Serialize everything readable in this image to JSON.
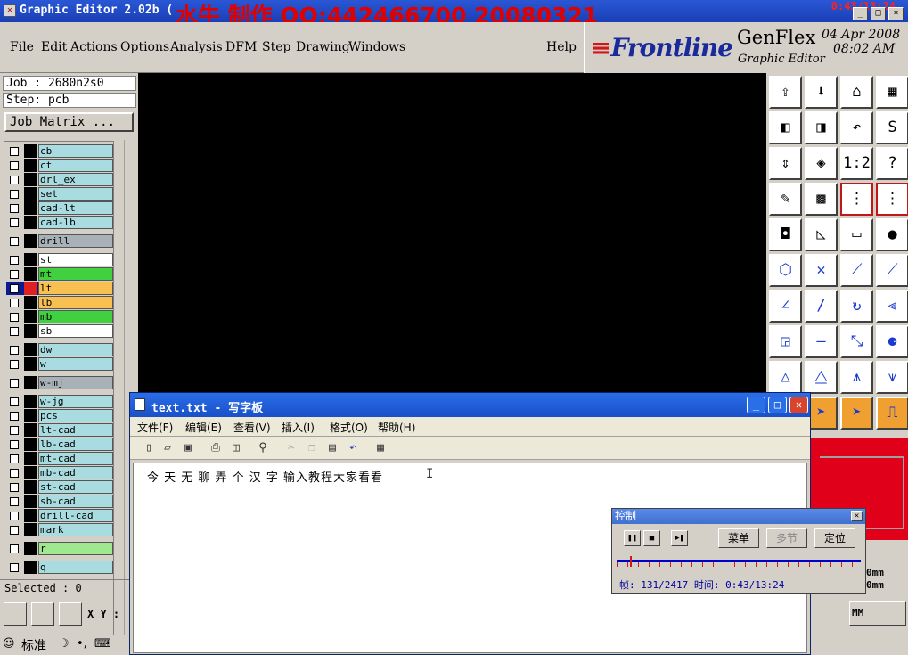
{
  "titlebar": {
    "title": "Graphic Editor 2.02b (",
    "overlay": "水牛 制作  QQ:442466700  20080321",
    "clock": "0:43/13:24",
    "min": "_",
    "max": "□",
    "close": "×"
  },
  "menu": [
    "File",
    "Edit",
    "Actions",
    "Options",
    "Analysis",
    "DFM",
    "Step",
    "Drawing",
    "Windows"
  ],
  "help": "Help",
  "brand": {
    "logo": "Frontline",
    "product": "GenFlex",
    "subtitle": "Graphic Editor",
    "date": "04 Apr 2008",
    "time": "08:02 AM"
  },
  "job": "Job : 2680n2s0",
  "step": "Step: pcb",
  "job_matrix": "Job Matrix ...",
  "layers": [
    {
      "name": "cb",
      "color": "#a8dce0",
      "swatch": "#000",
      "kind": "normal"
    },
    {
      "name": "ct",
      "color": "#a8dce0",
      "swatch": "#000",
      "kind": "normal"
    },
    {
      "name": "drl_ex",
      "color": "#a8dce0",
      "swatch": "#000",
      "kind": "normal"
    },
    {
      "name": "set",
      "color": "#a8dce0",
      "swatch": "#000",
      "kind": "normal"
    },
    {
      "name": "cad-lt",
      "color": "#a8dce0",
      "swatch": "#000",
      "kind": "normal"
    },
    {
      "name": "cad-lb",
      "color": "#a8dce0",
      "swatch": "#000",
      "kind": "normal"
    },
    {
      "name": "drill",
      "color": "#a8b0b8",
      "swatch": "#000",
      "kind": "drill"
    },
    {
      "name": "st",
      "color": "#ffffff",
      "swatch": "#000",
      "kind": "normal"
    },
    {
      "name": "mt",
      "color": "#40d040",
      "swatch": "#000",
      "kind": "normal"
    },
    {
      "name": "lt",
      "color": "#f8c050",
      "swatch": "#e02020",
      "kind": "active"
    },
    {
      "name": "lb",
      "color": "#f8c050",
      "swatch": "#000",
      "kind": "normal"
    },
    {
      "name": "mb",
      "color": "#40d040",
      "swatch": "#000",
      "kind": "normal"
    },
    {
      "name": "sb",
      "color": "#ffffff",
      "swatch": "#000",
      "kind": "normal"
    },
    {
      "name": "dw",
      "color": "#a8dce0",
      "swatch": "#000",
      "kind": "normal"
    },
    {
      "name": "w",
      "color": "#a8dce0",
      "swatch": "#000",
      "kind": "normal"
    },
    {
      "name": "w-mj",
      "color": "#a8b0b8",
      "swatch": "#000",
      "kind": "normal"
    },
    {
      "name": "w-jg",
      "color": "#a8dce0",
      "swatch": "#000",
      "kind": "normal"
    },
    {
      "name": "pcs",
      "color": "#a8dce0",
      "swatch": "#000",
      "kind": "normal"
    },
    {
      "name": "lt-cad",
      "color": "#a8dce0",
      "swatch": "#000",
      "kind": "normal"
    },
    {
      "name": "lb-cad",
      "color": "#a8dce0",
      "swatch": "#000",
      "kind": "normal"
    },
    {
      "name": "mt-cad",
      "color": "#a8dce0",
      "swatch": "#000",
      "kind": "normal"
    },
    {
      "name": "mb-cad",
      "color": "#a8dce0",
      "swatch": "#000",
      "kind": "normal"
    },
    {
      "name": "st-cad",
      "color": "#a8dce0",
      "swatch": "#000",
      "kind": "normal"
    },
    {
      "name": "sb-cad",
      "color": "#a8dce0",
      "swatch": "#000",
      "kind": "normal"
    },
    {
      "name": "drill-cad",
      "color": "#a8dce0",
      "swatch": "#000",
      "kind": "normal"
    },
    {
      "name": "mark",
      "color": "#a8dce0",
      "swatch": "#000",
      "kind": "normal"
    },
    {
      "name": "r",
      "color": "#a0e890",
      "swatch": "#000",
      "kind": "normal"
    },
    {
      "name": "q",
      "color": "#a8dce0",
      "swatch": "#000",
      "kind": "normal"
    }
  ],
  "selected": "Selected : 0",
  "xy": "X Y :",
  "right_info": {
    "v1": "0mm",
    "v2": "0mm",
    "units": "MM"
  },
  "taskbar": {
    "ime": "标准"
  },
  "tools": [
    {
      "icon": "export-icon",
      "glyph": "⇪"
    },
    {
      "icon": "import-icon",
      "glyph": "⬇"
    },
    {
      "icon": "home-icon",
      "glyph": "⌂"
    },
    {
      "icon": "window-icon",
      "glyph": "▦"
    },
    {
      "icon": "pan-left-icon",
      "glyph": "◧"
    },
    {
      "icon": "pan-right-icon",
      "glyph": "◨"
    },
    {
      "icon": "undo-icon",
      "glyph": "↶"
    },
    {
      "icon": "redraw-icon",
      "glyph": "S"
    },
    {
      "icon": "fit-icon",
      "glyph": "⇕"
    },
    {
      "icon": "zoom-icon",
      "glyph": "◈"
    },
    {
      "icon": "ratio-icon",
      "glyph": "1:2"
    },
    {
      "icon": "help-icon",
      "glyph": "?"
    },
    {
      "icon": "tools-icon",
      "glyph": "✎"
    },
    {
      "icon": "grid-icon",
      "glyph": "▩"
    },
    {
      "icon": "net-icon",
      "glyph": "⋮"
    },
    {
      "icon": "net2-icon",
      "glyph": "⋮"
    },
    {
      "icon": "select-icon",
      "glyph": "◘"
    },
    {
      "icon": "polygon-icon",
      "glyph": "◺"
    },
    {
      "icon": "ruler-icon",
      "glyph": "▭"
    },
    {
      "icon": "dot-icon",
      "glyph": "●"
    },
    {
      "icon": "route-icon",
      "glyph": "⬡"
    },
    {
      "icon": "cross-icon",
      "glyph": "✕"
    },
    {
      "icon": "line-icon",
      "glyph": "⟋"
    },
    {
      "icon": "line2-icon",
      "glyph": "⟋"
    },
    {
      "icon": "angle-icon",
      "glyph": "∠"
    },
    {
      "icon": "slash-icon",
      "glyph": "∕"
    },
    {
      "icon": "arc-icon",
      "glyph": "↻"
    },
    {
      "icon": "mirror-icon",
      "glyph": "⫷"
    },
    {
      "icon": "move-icon",
      "glyph": "◲"
    },
    {
      "icon": "dash-icon",
      "glyph": "—"
    },
    {
      "icon": "stretch-icon",
      "glyph": "⤡"
    },
    {
      "icon": "pads-icon",
      "glyph": "⚈"
    },
    {
      "icon": "tri1-icon",
      "glyph": "△"
    },
    {
      "icon": "tri2-icon",
      "glyph": "⧋"
    },
    {
      "icon": "tri3-icon",
      "glyph": "⩚"
    },
    {
      "icon": "tri4-icon",
      "glyph": "⩛"
    },
    {
      "icon": "pointer-icon",
      "glyph": "➤"
    },
    {
      "icon": "pointer2-icon",
      "glyph": "➤"
    },
    {
      "icon": "pointer3-icon",
      "glyph": "➤"
    },
    {
      "icon": "step-icon",
      "glyph": "⎍"
    }
  ],
  "wordpad": {
    "title": "text.txt - 写字板",
    "menu": [
      "文件(F)",
      "编辑(E)",
      "查看(V)",
      "插入(I)",
      "格式(O)",
      "帮助(H)"
    ],
    "text": "今 天 无 聊 弄 个 汉 字 输入教程大家看看"
  },
  "control": {
    "title": "控制",
    "menu_btn": "菜单",
    "section_btn": "多节",
    "locate_btn": "定位",
    "progress": 0.054,
    "status": "帧: 131/2417 时间: 0:43/13:24"
  }
}
